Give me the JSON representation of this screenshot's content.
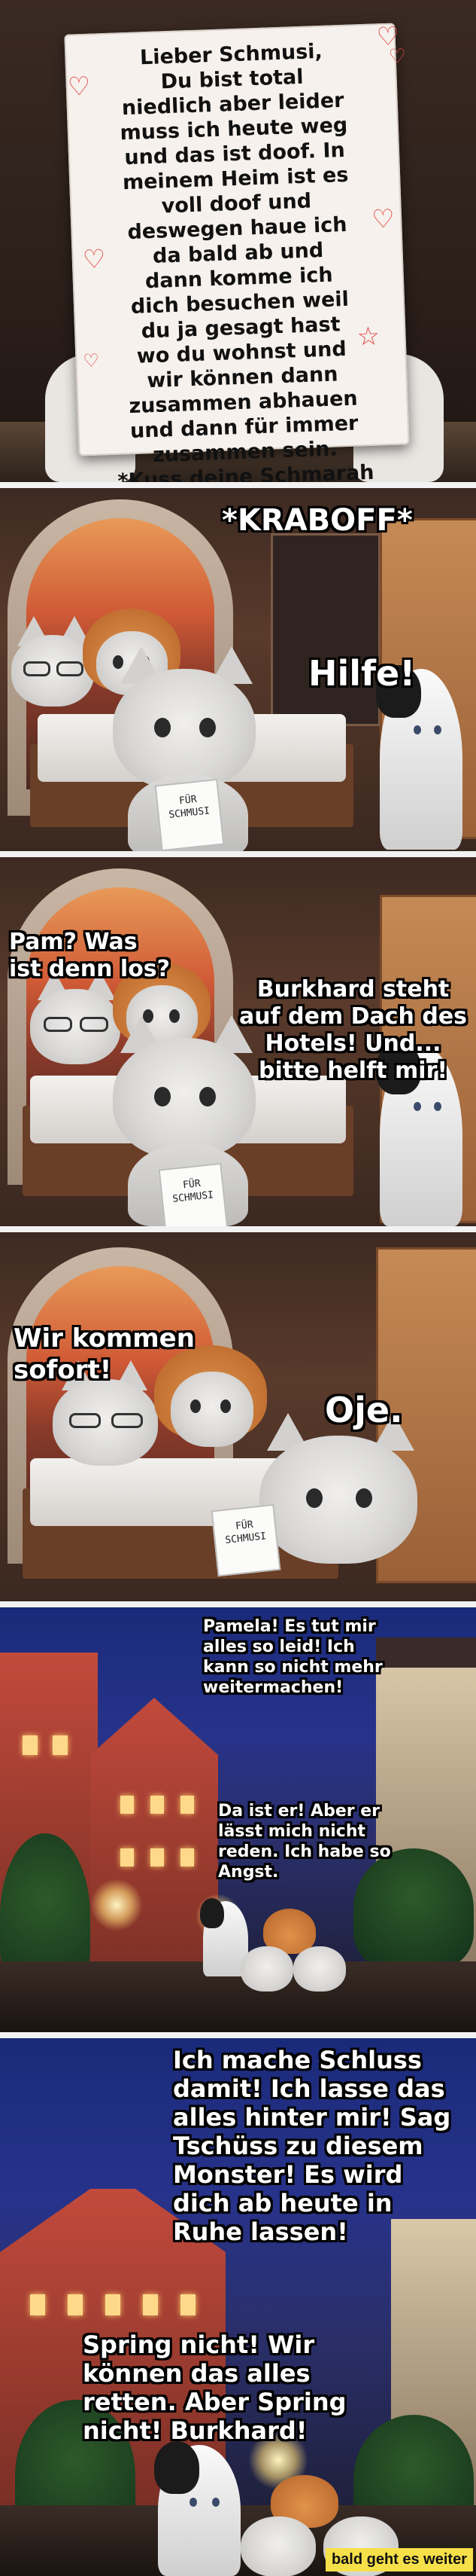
{
  "panel1": {
    "letter_lines": [
      "Lieber Schmusi,",
      "Du bist total",
      "niedlich aber leider",
      "muss ich heute weg",
      "und das ist doof. In",
      "meinem Heim ist es",
      "voll doof und",
      "deswegen haue ich",
      "da bald ab und",
      "dann komme ich",
      "dich besuchen weil",
      "du ja gesagt hast",
      "wo du wohnst und",
      "wir können dann",
      "zusammen abhauen",
      "und dann für immer",
      "zusammen sein.",
      "*Kuss deine Schmarah"
    ]
  },
  "panel2": {
    "sound": "*KRABOFF*",
    "bubble": "Hilfe!",
    "sign_lines": [
      "FÜR",
      "SCHMUSI"
    ]
  },
  "panel3": {
    "bubble_left": [
      "Pam? Was",
      "ist denn los?"
    ],
    "bubble_right": [
      "Burkhard steht",
      "auf dem Dach des",
      "Hotels! Und...",
      "bitte helft mir!"
    ],
    "sign_lines": [
      "FÜR",
      "SCHMUSI"
    ]
  },
  "panel4": {
    "bubble_left": [
      "Wir kommen",
      "sofort!"
    ],
    "bubble_right": "Oje.",
    "sign_lines": [
      "FÜR",
      "SCHMUSI"
    ]
  },
  "panel5": {
    "bubble_top": [
      "Pamela! Es tut mir",
      "alles so leid! Ich",
      "kann so nicht mehr",
      "weitermachen!"
    ],
    "bubble_mid": [
      "Da ist er! Aber er",
      "lässt mich nicht",
      "reden. Ich habe so",
      "Angst."
    ]
  },
  "panel6": {
    "bubble_top": [
      "Ich mache Schluss",
      "damit! Ich lasse das",
      "alles hinter mir! Sag",
      "Tschüss zu diesem",
      "Monster! Es wird",
      "dich ab heute in",
      "Ruhe lassen!"
    ],
    "bubble_bottom": [
      "Spring nicht! Wir",
      "können das alles",
      "retten. Aber Spring",
      "nicht! Burkhard!"
    ],
    "credit": "bald geht es weiter"
  }
}
